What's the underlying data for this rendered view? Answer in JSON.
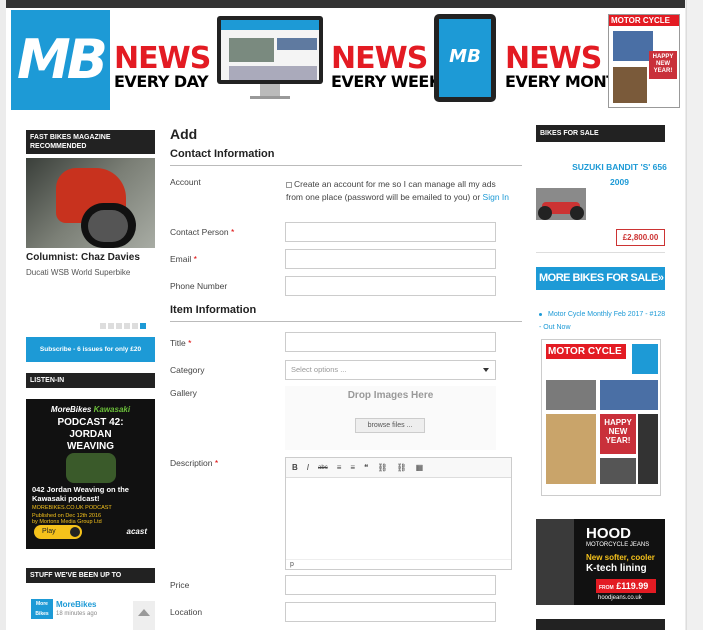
{
  "banner": {
    "logo": "MB",
    "news_day": {
      "word": "NEWS",
      "sub": "EVERY DAY"
    },
    "news_week": {
      "word": "NEWS",
      "sub": "EVERY WEEK"
    },
    "news_month": {
      "word": "NEWS",
      "sub": "EVERY MONTH"
    },
    "tablet_logo": "MB",
    "magazine_title": "MOTOR CYCLE",
    "magazine_tag": "HAPPY NEW YEAR!"
  },
  "left": {
    "fast_bikes_head": "FAST BIKES MAGAZINE RECOMMENDED",
    "columnist_title": "Columnist: Chaz Davies",
    "columnist_sub": "Ducati WSB World Superbike",
    "subscribe": "Subscribe - 6 issues for only £20",
    "listen_head": "LISTEN-IN",
    "podcast": {
      "brand": "MoreBikes",
      "brand2": "Kawasaki",
      "line1": "PODCAST 42:",
      "line2": "JORDAN",
      "line3": "WEAVING",
      "desc": "042 Jordan Weaving on the Kawasaki podcast!",
      "site": "MOREBIKES.CO.UK PODCAST",
      "published": "Published on Dec 12th 2016",
      "by": "by Mortons Media Group Ltd",
      "play": "Play",
      "acast": "acast"
    },
    "stuff_head": "STUFF WE'VE BEEN UP TO",
    "feed_name": "MoreBikes",
    "feed_time": "18 minutes ago",
    "feed_logo": "More Bikes"
  },
  "form": {
    "title": "Add",
    "contact_head": "Contact Information",
    "account_label": "Account",
    "account_text": "Create an account for me so I can manage all my ads from one place (password will be emailed to you) or",
    "sign_in": "Sign In",
    "contact_person": "Contact Person",
    "email": "Email",
    "phone": "Phone Number",
    "item_head": "Item Information",
    "title_label": "Title",
    "category_label": "Category",
    "category_placeholder": "Select options ...",
    "gallery_label": "Gallery",
    "drop_text": "Drop Images Here",
    "browse": "browse files ...",
    "description_label": "Description",
    "editor_status": "p",
    "editor_tools": [
      "B",
      "I",
      "abc",
      "≡",
      "≡",
      "❝",
      "⛓",
      "⛓",
      "▦"
    ],
    "price_label": "Price",
    "location_label": "Location",
    "required_mark": "*"
  },
  "right": {
    "bikes_head": "BIKES FOR SALE",
    "bike_name": "SUZUKI BANDIT 'S' 656 2009",
    "bike_price": "£2,800.00",
    "more_bikes": "MORE BIKES FOR SALE»",
    "mc_link": "Motor Cycle Monthly Feb 2017 - #128 - Out Now",
    "mag_title": "MOTOR CYCLE",
    "mag_tag": "HAPPY NEW YEAR!",
    "hood": {
      "brand": "HOOD",
      "sub": "MOTORCYCLE JEANS",
      "line1": "New softer, cooler",
      "line2": "K-tech lining",
      "from": "FROM",
      "price": "£119.99",
      "site": "hoodjeans.co.uk"
    }
  },
  "colors": {
    "accent": "#1d9ad6",
    "red": "#e31b23",
    "dark": "#222222"
  }
}
